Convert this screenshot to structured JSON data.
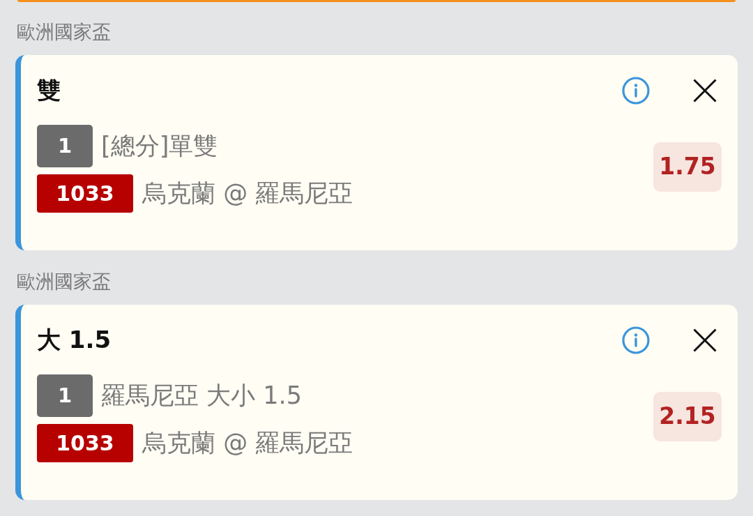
{
  "bets": [
    {
      "league": "歐洲國家盃",
      "selection": "雙",
      "market_number": "1",
      "market": "[總分]單雙",
      "match_number": "1033",
      "match": "烏克蘭 @ 羅馬尼亞",
      "odds": "1.75"
    },
    {
      "league": "歐洲國家盃",
      "selection": "大 1.5",
      "market_number": "1",
      "market": "羅馬尼亞 大小 1.5",
      "match_number": "1033",
      "match": "烏克蘭 @ 羅馬尼亞",
      "odds": "2.15"
    }
  ]
}
